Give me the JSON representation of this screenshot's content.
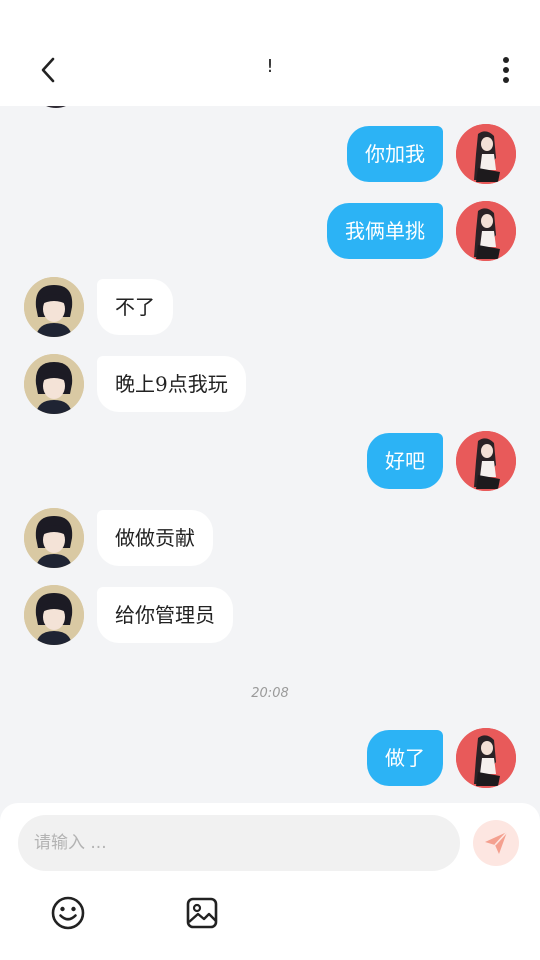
{
  "header": {
    "title": "!",
    "back_icon": "chevron-left-icon",
    "more_icon": "more-vertical-icon"
  },
  "messages": [
    {
      "from": "me",
      "text": "你加我"
    },
    {
      "from": "me",
      "text": "我俩单挑"
    },
    {
      "from": "other",
      "text": "不了"
    },
    {
      "from": "other",
      "text": "晚上9点我玩"
    },
    {
      "from": "me",
      "text": "好吧"
    },
    {
      "from": "other",
      "text": "做做贡献"
    },
    {
      "from": "other",
      "text": "给你管理员"
    },
    {
      "from": "me",
      "text": "做了"
    }
  ],
  "timestamp": "20:08",
  "composer": {
    "placeholder": "请输入 ...",
    "send_icon": "send-icon",
    "emoji_icon": "emoji-icon",
    "image_icon": "image-icon"
  },
  "colors": {
    "my_bubble": "#2cb3f5",
    "other_bubble": "#ffffff",
    "send_button_bg": "#fde6e1",
    "send_icon": "#f4a08f"
  }
}
